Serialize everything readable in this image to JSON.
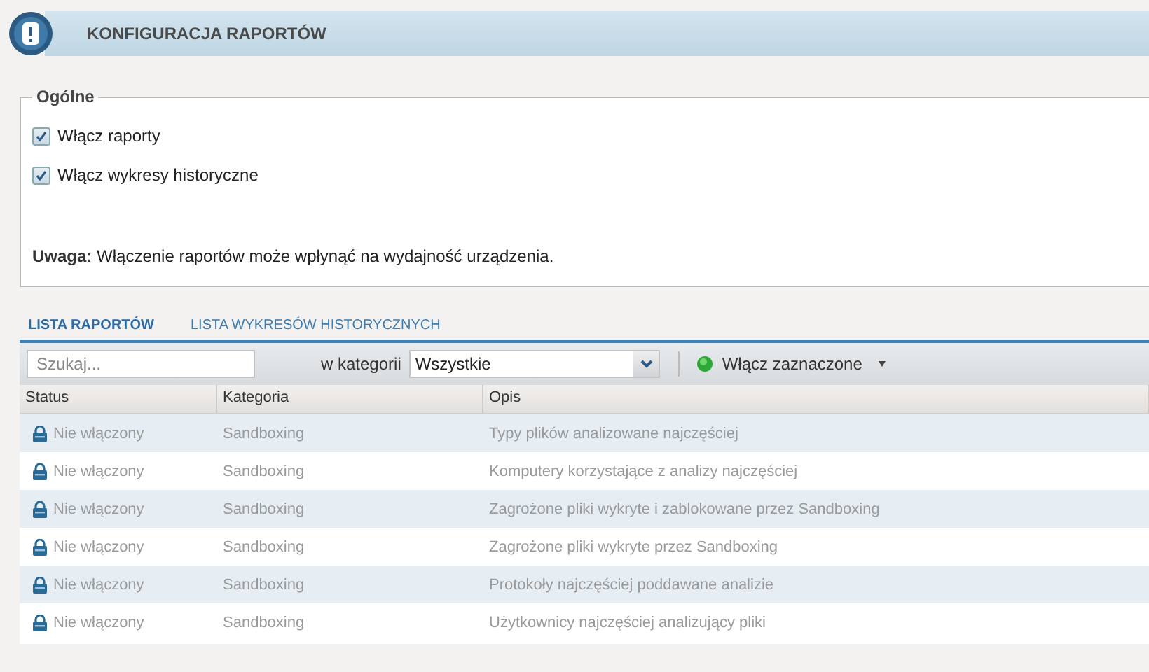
{
  "header": {
    "title": "KONFIGURACJA RAPORTÓW"
  },
  "general": {
    "legend": "Ogólne",
    "options": [
      {
        "label": "Włącz raporty",
        "checked": true
      },
      {
        "label": "Włącz wykresy historyczne",
        "checked": true
      }
    ],
    "note": "**Uwaga:** Włączenie raportów może wpłynąć na wydajność urządzenia."
  },
  "tabs": [
    {
      "label": "LISTA RAPORTÓW",
      "selected": true
    },
    {
      "label": "LISTA WYKRESÓW HISTORYCZNYCH",
      "selected": false
    }
  ],
  "toolbar": {
    "search": {
      "placeholder": "Szukaj..."
    },
    "category_label": "w kategorii",
    "category": "Wszystkie",
    "action": "Włącz zaznaczone"
  },
  "table": {
    "columns": [
      "Status",
      "Kategoria",
      "Opis"
    ],
    "rows": [
      {
        "status": "Nie włączony",
        "category": "Sandboxing",
        "description": "Typy plików analizowane najczęściej"
      },
      {
        "status": "Nie włączony",
        "category": "Sandboxing",
        "description": "Komputery korzystające z analizy najczęściej"
      },
      {
        "status": "Nie włączony",
        "category": "Sandboxing",
        "description": "Zagrożone pliki wykryte i zablokowane przez Sandboxing"
      },
      {
        "status": "Nie włączony",
        "category": "Sandboxing",
        "description": "Zagrożone pliki wykryte przez Sandboxing"
      },
      {
        "status": "Nie włączony",
        "category": "Sandboxing",
        "description": "Protokoły najczęściej poddawane analizie"
      },
      {
        "status": "Nie włączony",
        "category": "Sandboxing",
        "description": "Użytkownicy najczęściej analizujący pliki"
      }
    ]
  }
}
